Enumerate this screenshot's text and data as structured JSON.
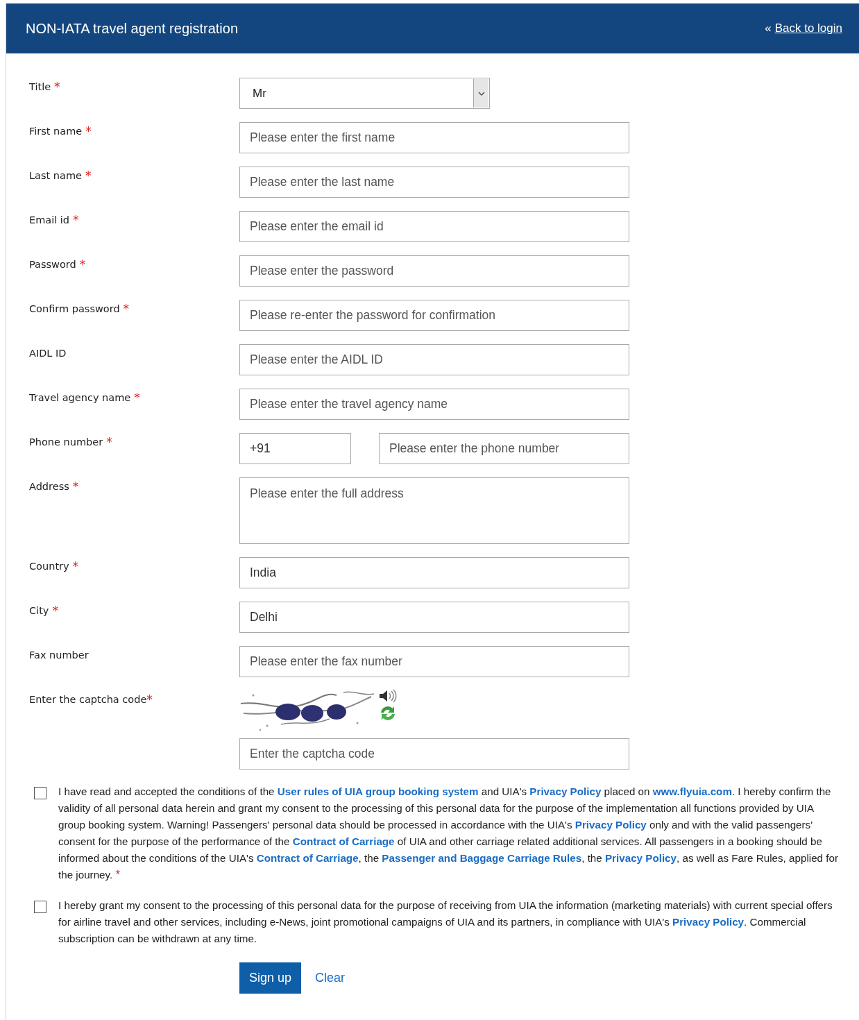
{
  "header": {
    "title": "NON-IATA travel agent registration",
    "back_link": {
      "prefix": "«",
      "label": "Back to login"
    }
  },
  "fields": [
    {
      "kind": "select",
      "label": "Title",
      "asterisk": "*",
      "value": "Mr"
    },
    {
      "kind": "input",
      "label": "First name",
      "asterisk": "*",
      "placeholder": "Please enter the first name"
    },
    {
      "kind": "input",
      "label": "Last name",
      "asterisk": "*",
      "placeholder": "Please enter the last name"
    },
    {
      "kind": "input",
      "label": "Email id",
      "asterisk": "*",
      "placeholder": "Please enter the email id"
    },
    {
      "kind": "input",
      "label": "Password",
      "asterisk": "*",
      "placeholder": "Please enter the password"
    },
    {
      "kind": "input",
      "label": "Confirm password",
      "asterisk": "*",
      "placeholder": "Please re-enter the password for confirmation"
    },
    {
      "kind": "input",
      "label": "AIDL ID",
      "placeholder": "Please enter the AIDL ID"
    },
    {
      "kind": "input",
      "label": "Travel agency name",
      "asterisk": "*",
      "placeholder": "Please enter the travel agency name"
    },
    {
      "kind": "phone",
      "label": "Phone number",
      "asterisk": "*",
      "code": "+91",
      "placeholder": "Please enter the phone number"
    },
    {
      "kind": "textarea",
      "label": "Address",
      "asterisk": "*",
      "placeholder": "Please enter the full address"
    },
    {
      "kind": "input",
      "label": "Country",
      "asterisk": "*",
      "value": "India"
    },
    {
      "kind": "input",
      "label": "City",
      "asterisk": "*",
      "value": "Delhi"
    },
    {
      "kind": "input",
      "label": "Fax number",
      "placeholder": "Please enter the fax number"
    },
    {
      "kind": "captcha",
      "label": "Enter the captcha code",
      "asterisk": "*",
      "placeholder": "Enter the captcha code"
    }
  ],
  "consents": [
    {
      "checked": false,
      "asterisk": "*",
      "segments": [
        {
          "kind": "text",
          "text": "I have read and accepted the conditions of the "
        },
        {
          "kind": "link",
          "text": "User rules of UIA group booking system"
        },
        {
          "kind": "text",
          "text": " and UIA's "
        },
        {
          "kind": "link",
          "text": "Privacy Policy"
        },
        {
          "kind": "text",
          "text": " placed on "
        },
        {
          "kind": "link",
          "text": "www.flyuia.com"
        },
        {
          "kind": "text",
          "text": ". I hereby confirm the validity of all personal data herein and grant my consent to the processing of this personal data for the purpose of the implementation all functions provided by UIA group booking system. Warning! Passengers' personal data should be processed in accordance with the UIA's "
        },
        {
          "kind": "link",
          "text": "Privacy Policy"
        },
        {
          "kind": "text",
          "text": " only and with the valid passengers' consent for the purpose of the performance of the "
        },
        {
          "kind": "link",
          "text": "Contract of Carriage"
        },
        {
          "kind": "text",
          "text": " of UIA and other carriage related additional services. All passengers in a booking should be informed about the conditions of the UIA's "
        },
        {
          "kind": "link",
          "text": "Contract of Carriage"
        },
        {
          "kind": "text",
          "text": ", the "
        },
        {
          "kind": "link",
          "text": "Passenger and Baggage Carriage Rules"
        },
        {
          "kind": "text",
          "text": ", the "
        },
        {
          "kind": "link",
          "text": "Privacy Policy"
        },
        {
          "kind": "text",
          "text": ", as well as Fare Rules, applied for the journey."
        }
      ]
    },
    {
      "checked": false,
      "segments": [
        {
          "kind": "text",
          "text": "I hereby grant my consent to the processing of this personal data for the purpose of receiving from UIA the information (marketing materials) with current special offers for airline travel and other services, including e-News, joint promotional campaigns of UIA and its partners, in compliance with UIA's "
        },
        {
          "kind": "link",
          "text": "Privacy Policy"
        },
        {
          "kind": "text",
          "text": ". Commercial subscription can be withdrawn at any time."
        }
      ]
    }
  ],
  "buttons": {
    "submit": "Sign up",
    "clear": "Clear"
  }
}
